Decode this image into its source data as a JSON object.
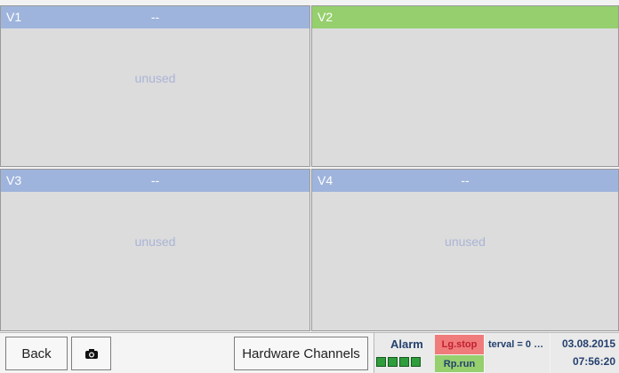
{
  "panels": [
    {
      "id": "V1",
      "value": "--",
      "content": "unused",
      "header_color": "#9eb4dc"
    },
    {
      "id": "V2",
      "value": "",
      "content": "",
      "header_color": "#95cf6e"
    },
    {
      "id": "V3",
      "value": "--",
      "content": "unused",
      "header_color": "#9eb4dc"
    },
    {
      "id": "V4",
      "value": "--",
      "content": "unused",
      "header_color": "#9eb4dc"
    }
  ],
  "toolbar": {
    "back_label": "Back",
    "camera_icon": "camera-icon",
    "hardware_label": "Hardware Channels"
  },
  "status": {
    "alarm_label": "Alarm",
    "alarm_segments": 4,
    "logger_state": "Lg.stop",
    "report_state": "Rp.run",
    "interval_text": "terval = 0 …",
    "date": "03.08.2015",
    "time": "07:56:20",
    "logger_color": "#f07b7b",
    "report_color": "#95cf6e"
  }
}
